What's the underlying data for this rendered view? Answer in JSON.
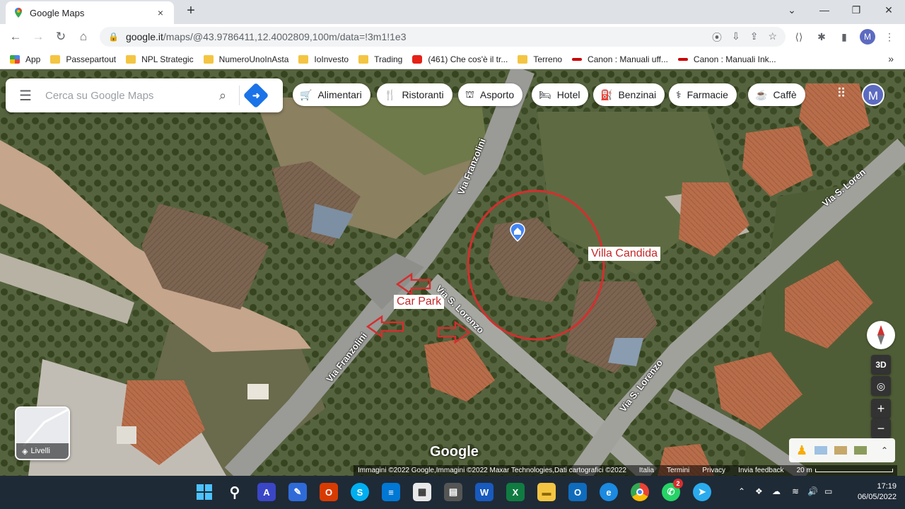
{
  "browser": {
    "tab_title": "Google Maps",
    "tab_close": "×",
    "new_tab": "+",
    "window_controls": {
      "minimize": "⌄",
      "restore": "—",
      "maximize": "❐",
      "close": "✕"
    },
    "url_host": "google.it",
    "url_path": "/maps/@43.9786411,12.4002809,100m/data=!3m1!1e3",
    "profile_initial": "M"
  },
  "bookmarks": [
    {
      "label": "App",
      "icon": "apps-grid-icon"
    },
    {
      "label": "Passepartout",
      "icon": "folder-icon"
    },
    {
      "label": "NPL Strategic",
      "icon": "folder-icon"
    },
    {
      "label": "NumeroUnoInAsta",
      "icon": "folder-icon"
    },
    {
      "label": "IoInvesto",
      "icon": "folder-icon"
    },
    {
      "label": "Trading",
      "icon": "folder-icon"
    },
    {
      "label": "(461) Che cos'è il tr...",
      "icon": "youtube-icon"
    },
    {
      "label": "Terreno",
      "icon": "folder-icon"
    },
    {
      "label": "Canon : Manuali uff...",
      "icon": "canon-icon"
    },
    {
      "label": "Canon : Manuali Ink...",
      "icon": "canon-icon"
    }
  ],
  "bookmarks_more": "»",
  "maps": {
    "search_placeholder": "Cerca su Google Maps",
    "chips": [
      {
        "label": "Alimentari",
        "icon": "🛒"
      },
      {
        "label": "Ristoranti",
        "icon": "🍴"
      },
      {
        "label": "Asporto",
        "icon": "⛫"
      },
      {
        "label": "Hotel",
        "icon": "🛏"
      },
      {
        "label": "Benzinai",
        "icon": "⛽"
      },
      {
        "label": "Farmacie",
        "icon": "⚕"
      },
      {
        "label": "Caffè",
        "icon": "☕"
      }
    ],
    "avatar_initial": "M",
    "annotations": {
      "villa": "Villa Candida",
      "carpark": "Car Park"
    },
    "roads": {
      "franzolini_top": "Via Franzolini",
      "franzolini_bottom": "Via Franzolini",
      "lorenzo_mid": "Via S. Lorenzo",
      "lorenzo_right": "Via S. Lorenzo",
      "lorenzo_top": "Via S. Loren"
    },
    "layers_label": "Livelli",
    "compass_3d": "3D",
    "zoom_in": "+",
    "zoom_out": "−",
    "google_logo": "Google",
    "attribution": [
      "Immagini ©2022 Google,Immagini ©2022 Maxar Technologies,Dati cartografici ©2022",
      "Italia",
      "Termini",
      "Privacy",
      "Invia feedback",
      "20 m"
    ]
  },
  "taskbar": {
    "time": "17:19",
    "date": "06/05/2022",
    "whatsapp_badge": "2"
  }
}
